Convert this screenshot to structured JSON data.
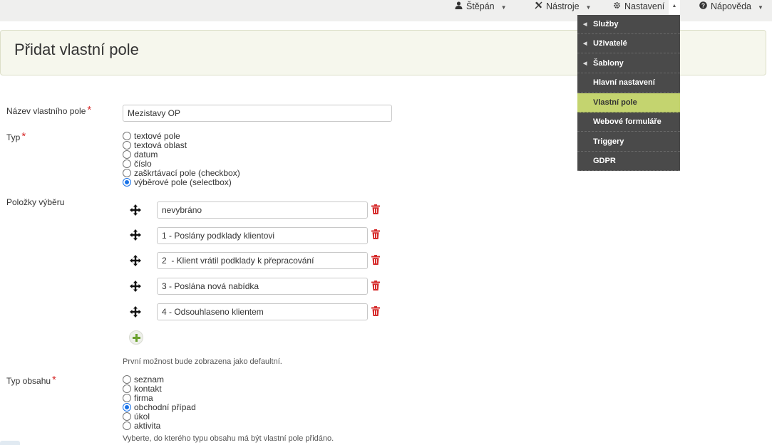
{
  "topnav": {
    "user": "Štěpán",
    "tools": "Nástroje",
    "settings": "Nastavení",
    "help": "Nápověda"
  },
  "settings_menu": {
    "items": [
      {
        "label": "Služby",
        "submenu": true
      },
      {
        "label": "Uživatelé",
        "submenu": true
      },
      {
        "label": "Šablony",
        "submenu": true
      },
      {
        "label": "Hlavní nastavení",
        "submenu": false
      },
      {
        "label": "Vlastní pole",
        "submenu": false,
        "active": true
      },
      {
        "label": "Webové formuláře",
        "submenu": false
      },
      {
        "label": "Triggery",
        "submenu": false
      },
      {
        "label": "GDPR",
        "submenu": false
      }
    ]
  },
  "page": {
    "title": "Přidat vlastní pole"
  },
  "form": {
    "name_label": "Název vlastního pole",
    "name_value": "Mezistavy OP",
    "required_mark": "*",
    "type_label": "Typ",
    "type_options": [
      "textové pole",
      "textová oblast",
      "datum",
      "číslo",
      "zaškrtávací pole (checkbox)",
      "výběrové pole (selectbox)"
    ],
    "type_selected": "výběrové pole (selectbox)",
    "items_label": "Položky výběru",
    "items": [
      "nevybráno",
      "1 - Poslány podklady klientovi",
      "2  - Klient vrátil podklady k přepracování",
      "3 - Poslána nová nabídka",
      "4 - Odsouhlaseno klientem"
    ],
    "items_hint": "První možnost bude zobrazena jako defaultní.",
    "content_label": "Typ obsahu",
    "content_options": [
      "seznam",
      "kontakt",
      "firma",
      "obchodní případ",
      "úkol",
      "aktivita"
    ],
    "content_selected": "obchodní případ",
    "content_hint": "Vyberte, do kterého typu obsahu má být vlastní pole přidáno."
  },
  "colors": {
    "accent_green": "#c4d46f",
    "menu_bg": "#4a4a4a",
    "delete_red": "#d62b2b",
    "add_green": "#6aa12e"
  },
  "icons": [
    "user-icon",
    "tools-icon",
    "gear-icon",
    "help-icon",
    "move-icon",
    "trash-icon",
    "add-icon"
  ]
}
